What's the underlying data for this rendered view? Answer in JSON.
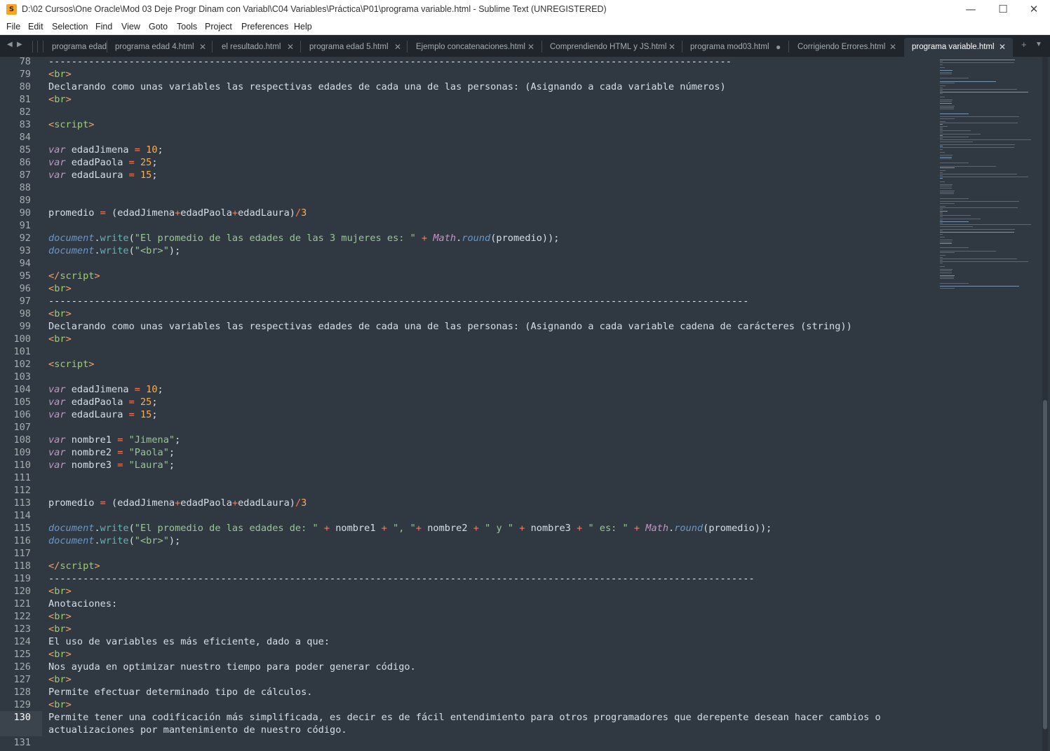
{
  "window": {
    "title": "D:\\02 Cursos\\One Oracle\\Mod 03 Deje Progr Dinam con Variabl\\C04 Variables\\Práctica\\P01\\programa variable.html - Sublime Text (UNREGISTERED)",
    "app_icon": "sublime-text-logo",
    "app_icon_glyph": "S",
    "minimize_glyph": "—",
    "maximize_glyph": "☐",
    "close_glyph": "✕"
  },
  "menu": [
    "File",
    "Edit",
    "Selection",
    "Find",
    "View",
    "Goto",
    "Tools",
    "Project",
    "Preferences",
    "Help"
  ],
  "tabs": [
    {
      "label": "programa edad",
      "close": "",
      "active": false
    },
    {
      "label": "programa edad 4.html",
      "close": "✕",
      "active": false
    },
    {
      "label": "el resultado.html",
      "close": "✕",
      "active": false
    },
    {
      "label": "programa edad 5.html",
      "close": "✕",
      "active": false
    },
    {
      "label": "Ejemplo concatenaciones.html",
      "close": "✕",
      "active": false
    },
    {
      "label": "Comprendiendo HTML y JS.html",
      "close": "✕",
      "active": false
    },
    {
      "label": "programa mod03.html",
      "close": "●",
      "active": false
    },
    {
      "label": "Corrigiendo Errores.html",
      "close": "✕",
      "active": false
    },
    {
      "label": "programa variable.html",
      "close": "✕",
      "active": true
    }
  ],
  "tabbar_icons": {
    "prev": "◀",
    "next": "▶",
    "new_tab": "+",
    "tab_list": "▼"
  },
  "editor": {
    "current_line": 130,
    "lines": [
      {
        "n": "78",
        "tokens": [
          {
            "t": "-----------------------------------------------------------------------------------------------------------------------",
            "c": "c-dash"
          }
        ]
      },
      {
        "n": "79",
        "tokens": [
          {
            "t": "<",
            "c": "c-tag"
          },
          {
            "t": "br",
            "c": "c-tagname"
          },
          {
            "t": ">",
            "c": "c-tag"
          }
        ]
      },
      {
        "n": "80",
        "tokens": [
          {
            "t": "Declarando como unas variables las respectivas edades de cada una de las personas: (Asignando a cada variable números)",
            "c": ""
          }
        ]
      },
      {
        "n": "81",
        "tokens": [
          {
            "t": "<",
            "c": "c-tag"
          },
          {
            "t": "br",
            "c": "c-tagname"
          },
          {
            "t": ">",
            "c": "c-tag"
          }
        ]
      },
      {
        "n": "82",
        "tokens": []
      },
      {
        "n": "83",
        "tokens": [
          {
            "t": "<",
            "c": "c-tag"
          },
          {
            "t": "script",
            "c": "c-tagname"
          },
          {
            "t": ">",
            "c": "c-tag"
          }
        ]
      },
      {
        "n": "84",
        "tokens": []
      },
      {
        "n": "85",
        "tokens": [
          {
            "t": "var",
            "c": "c-var"
          },
          {
            "t": " edadJimena ",
            "c": ""
          },
          {
            "t": "=",
            "c": "c-op"
          },
          {
            "t": " ",
            "c": ""
          },
          {
            "t": "10",
            "c": "c-num"
          },
          {
            "t": ";",
            "c": ""
          }
        ]
      },
      {
        "n": "86",
        "tokens": [
          {
            "t": "var",
            "c": "c-var"
          },
          {
            "t": " edadPaola ",
            "c": ""
          },
          {
            "t": "=",
            "c": "c-op"
          },
          {
            "t": " ",
            "c": ""
          },
          {
            "t": "25",
            "c": "c-num"
          },
          {
            "t": ";",
            "c": ""
          }
        ]
      },
      {
        "n": "87",
        "tokens": [
          {
            "t": "var",
            "c": "c-var"
          },
          {
            "t": " edadLaura ",
            "c": ""
          },
          {
            "t": "=",
            "c": "c-op"
          },
          {
            "t": " ",
            "c": ""
          },
          {
            "t": "15",
            "c": "c-num"
          },
          {
            "t": ";",
            "c": ""
          }
        ]
      },
      {
        "n": "88",
        "tokens": []
      },
      {
        "n": "89",
        "tokens": []
      },
      {
        "n": "90",
        "tokens": [
          {
            "t": "promedio ",
            "c": ""
          },
          {
            "t": "=",
            "c": "c-op"
          },
          {
            "t": " (edadJimena",
            "c": ""
          },
          {
            "t": "+",
            "c": "c-op"
          },
          {
            "t": "edadPaola",
            "c": ""
          },
          {
            "t": "+",
            "c": "c-op"
          },
          {
            "t": "edadLaura)",
            "c": ""
          },
          {
            "t": "/",
            "c": "c-op"
          },
          {
            "t": "3",
            "c": "c-num"
          }
        ]
      },
      {
        "n": "91",
        "tokens": []
      },
      {
        "n": "92",
        "tokens": [
          {
            "t": "document",
            "c": "c-obj"
          },
          {
            "t": ".",
            "c": ""
          },
          {
            "t": "write",
            "c": "c-func"
          },
          {
            "t": "(",
            "c": ""
          },
          {
            "t": "\"El promedio de las edades de las 3 mujeres es: \"",
            "c": "c-str"
          },
          {
            "t": " ",
            "c": ""
          },
          {
            "t": "+",
            "c": "c-op"
          },
          {
            "t": " ",
            "c": ""
          },
          {
            "t": "Math",
            "c": "c-builtin"
          },
          {
            "t": ".",
            "c": ""
          },
          {
            "t": "round",
            "c": "c-obj"
          },
          {
            "t": "(promedio));",
            "c": ""
          }
        ]
      },
      {
        "n": "93",
        "tokens": [
          {
            "t": "document",
            "c": "c-obj"
          },
          {
            "t": ".",
            "c": ""
          },
          {
            "t": "write",
            "c": "c-func"
          },
          {
            "t": "(",
            "c": ""
          },
          {
            "t": "\"<br>\"",
            "c": "c-str"
          },
          {
            "t": ");",
            "c": ""
          }
        ]
      },
      {
        "n": "94",
        "tokens": []
      },
      {
        "n": "95",
        "tokens": [
          {
            "t": "</",
            "c": "c-tag"
          },
          {
            "t": "script",
            "c": "c-tagname"
          },
          {
            "t": ">",
            "c": "c-tag"
          }
        ]
      },
      {
        "n": "96",
        "tokens": [
          {
            "t": "<",
            "c": "c-tag"
          },
          {
            "t": "br",
            "c": "c-tagname"
          },
          {
            "t": ">",
            "c": "c-tag"
          }
        ]
      },
      {
        "n": "97",
        "tokens": [
          {
            "t": "--------------------------------------------------------------------------------------------------------------------------",
            "c": "c-dash"
          }
        ]
      },
      {
        "n": "98",
        "tokens": [
          {
            "t": "<",
            "c": "c-tag"
          },
          {
            "t": "br",
            "c": "c-tagname"
          },
          {
            "t": ">",
            "c": "c-tag"
          }
        ]
      },
      {
        "n": "99",
        "tokens": [
          {
            "t": "Declarando como unas variables las respectivas edades de cada una de las personas: (Asignando a cada variable cadena de carácteres (string))",
            "c": ""
          }
        ]
      },
      {
        "n": "100",
        "tokens": [
          {
            "t": "<",
            "c": "c-tag"
          },
          {
            "t": "br",
            "c": "c-tagname"
          },
          {
            "t": ">",
            "c": "c-tag"
          }
        ]
      },
      {
        "n": "101",
        "tokens": []
      },
      {
        "n": "102",
        "tokens": [
          {
            "t": "<",
            "c": "c-tag"
          },
          {
            "t": "script",
            "c": "c-tagname"
          },
          {
            "t": ">",
            "c": "c-tag"
          }
        ]
      },
      {
        "n": "103",
        "tokens": []
      },
      {
        "n": "104",
        "tokens": [
          {
            "t": "var",
            "c": "c-var"
          },
          {
            "t": " edadJimena ",
            "c": ""
          },
          {
            "t": "=",
            "c": "c-op"
          },
          {
            "t": " ",
            "c": ""
          },
          {
            "t": "10",
            "c": "c-num"
          },
          {
            "t": ";",
            "c": ""
          }
        ]
      },
      {
        "n": "105",
        "tokens": [
          {
            "t": "var",
            "c": "c-var"
          },
          {
            "t": " edadPaola ",
            "c": ""
          },
          {
            "t": "=",
            "c": "c-op"
          },
          {
            "t": " ",
            "c": ""
          },
          {
            "t": "25",
            "c": "c-num"
          },
          {
            "t": ";",
            "c": ""
          }
        ]
      },
      {
        "n": "106",
        "tokens": [
          {
            "t": "var",
            "c": "c-var"
          },
          {
            "t": " edadLaura ",
            "c": ""
          },
          {
            "t": "=",
            "c": "c-op"
          },
          {
            "t": " ",
            "c": ""
          },
          {
            "t": "15",
            "c": "c-num"
          },
          {
            "t": ";",
            "c": ""
          }
        ]
      },
      {
        "n": "107",
        "tokens": []
      },
      {
        "n": "108",
        "tokens": [
          {
            "t": "var",
            "c": "c-var"
          },
          {
            "t": " nombre1 ",
            "c": ""
          },
          {
            "t": "=",
            "c": "c-op"
          },
          {
            "t": " ",
            "c": ""
          },
          {
            "t": "\"Jimena\"",
            "c": "c-str"
          },
          {
            "t": ";",
            "c": ""
          }
        ]
      },
      {
        "n": "109",
        "tokens": [
          {
            "t": "var",
            "c": "c-var"
          },
          {
            "t": " nombre2 ",
            "c": ""
          },
          {
            "t": "=",
            "c": "c-op"
          },
          {
            "t": " ",
            "c": ""
          },
          {
            "t": "\"Paola\"",
            "c": "c-str"
          },
          {
            "t": ";",
            "c": ""
          }
        ]
      },
      {
        "n": "110",
        "tokens": [
          {
            "t": "var",
            "c": "c-var"
          },
          {
            "t": " nombre3 ",
            "c": ""
          },
          {
            "t": "=",
            "c": "c-op"
          },
          {
            "t": " ",
            "c": ""
          },
          {
            "t": "\"Laura\"",
            "c": "c-str"
          },
          {
            "t": ";",
            "c": ""
          }
        ]
      },
      {
        "n": "111",
        "tokens": []
      },
      {
        "n": "112",
        "tokens": []
      },
      {
        "n": "113",
        "tokens": [
          {
            "t": "promedio ",
            "c": ""
          },
          {
            "t": "=",
            "c": "c-op"
          },
          {
            "t": " (edadJimena",
            "c": ""
          },
          {
            "t": "+",
            "c": "c-op"
          },
          {
            "t": "edadPaola",
            "c": ""
          },
          {
            "t": "+",
            "c": "c-op"
          },
          {
            "t": "edadLaura)",
            "c": ""
          },
          {
            "t": "/",
            "c": "c-op"
          },
          {
            "t": "3",
            "c": "c-num"
          }
        ]
      },
      {
        "n": "114",
        "tokens": []
      },
      {
        "n": "115",
        "tokens": [
          {
            "t": "document",
            "c": "c-obj"
          },
          {
            "t": ".",
            "c": ""
          },
          {
            "t": "write",
            "c": "c-func"
          },
          {
            "t": "(",
            "c": ""
          },
          {
            "t": "\"El promedio de las edades de: \"",
            "c": "c-str"
          },
          {
            "t": " ",
            "c": ""
          },
          {
            "t": "+",
            "c": "c-op"
          },
          {
            "t": " nombre1 ",
            "c": ""
          },
          {
            "t": "+",
            "c": "c-op"
          },
          {
            "t": " ",
            "c": ""
          },
          {
            "t": "\", \"",
            "c": "c-str"
          },
          {
            "t": "+",
            "c": "c-op"
          },
          {
            "t": " nombre2 ",
            "c": ""
          },
          {
            "t": "+",
            "c": "c-op"
          },
          {
            "t": " ",
            "c": ""
          },
          {
            "t": "\" y \"",
            "c": "c-str"
          },
          {
            "t": " ",
            "c": ""
          },
          {
            "t": "+",
            "c": "c-op"
          },
          {
            "t": " nombre3 ",
            "c": ""
          },
          {
            "t": "+",
            "c": "c-op"
          },
          {
            "t": " ",
            "c": ""
          },
          {
            "t": "\" es: \"",
            "c": "c-str"
          },
          {
            "t": " ",
            "c": ""
          },
          {
            "t": "+",
            "c": "c-op"
          },
          {
            "t": " ",
            "c": ""
          },
          {
            "t": "Math",
            "c": "c-builtin"
          },
          {
            "t": ".",
            "c": ""
          },
          {
            "t": "round",
            "c": "c-obj"
          },
          {
            "t": "(promedio));",
            "c": ""
          }
        ]
      },
      {
        "n": "116",
        "tokens": [
          {
            "t": "document",
            "c": "c-obj"
          },
          {
            "t": ".",
            "c": ""
          },
          {
            "t": "write",
            "c": "c-func"
          },
          {
            "t": "(",
            "c": ""
          },
          {
            "t": "\"<br>\"",
            "c": "c-str"
          },
          {
            "t": ");",
            "c": ""
          }
        ]
      },
      {
        "n": "117",
        "tokens": []
      },
      {
        "n": "118",
        "tokens": [
          {
            "t": "</",
            "c": "c-tag"
          },
          {
            "t": "script",
            "c": "c-tagname"
          },
          {
            "t": ">",
            "c": "c-tag"
          }
        ]
      },
      {
        "n": "119",
        "tokens": [
          {
            "t": "---------------------------------------------------------------------------------------------------------------------------",
            "c": "c-dash"
          }
        ]
      },
      {
        "n": "120",
        "tokens": [
          {
            "t": "<",
            "c": "c-tag"
          },
          {
            "t": "br",
            "c": "c-tagname"
          },
          {
            "t": ">",
            "c": "c-tag"
          }
        ]
      },
      {
        "n": "121",
        "tokens": [
          {
            "t": "Anotaciones:",
            "c": ""
          }
        ]
      },
      {
        "n": "122",
        "tokens": [
          {
            "t": "<",
            "c": "c-tag"
          },
          {
            "t": "br",
            "c": "c-tagname"
          },
          {
            "t": ">",
            "c": "c-tag"
          }
        ]
      },
      {
        "n": "123",
        "tokens": [
          {
            "t": "<",
            "c": "c-tag"
          },
          {
            "t": "br",
            "c": "c-tagname"
          },
          {
            "t": ">",
            "c": "c-tag"
          }
        ]
      },
      {
        "n": "124",
        "tokens": [
          {
            "t": "El uso de variables es más eficiente, dado a que:",
            "c": ""
          }
        ]
      },
      {
        "n": "125",
        "tokens": [
          {
            "t": "<",
            "c": "c-tag"
          },
          {
            "t": "br",
            "c": "c-tagname"
          },
          {
            "t": ">",
            "c": "c-tag"
          }
        ]
      },
      {
        "n": "126",
        "tokens": [
          {
            "t": "Nos ayuda en optimizar nuestro tiempo para poder generar código.",
            "c": ""
          }
        ]
      },
      {
        "n": "127",
        "tokens": [
          {
            "t": "<",
            "c": "c-tag"
          },
          {
            "t": "br",
            "c": "c-tagname"
          },
          {
            "t": ">",
            "c": "c-tag"
          }
        ]
      },
      {
        "n": "128",
        "tokens": [
          {
            "t": "Permite efectuar determinado tipo de cálculos.",
            "c": ""
          }
        ]
      },
      {
        "n": "129",
        "tokens": [
          {
            "t": "<",
            "c": "c-tag"
          },
          {
            "t": "br",
            "c": "c-tagname"
          },
          {
            "t": ">",
            "c": "c-tag"
          }
        ]
      },
      {
        "n": "130",
        "tokens": [
          {
            "t": "Permite tener una codificación más simplificada, es decir es de fácil entendimiento para otros programadores que derepente desean hacer cambios o",
            "c": ""
          }
        ]
      },
      {
        "n": "",
        "tokens": [
          {
            "t": "actualizaciones por mantenimiento de nuestro código.",
            "c": ""
          }
        ]
      },
      {
        "n": "131",
        "tokens": []
      }
    ]
  }
}
